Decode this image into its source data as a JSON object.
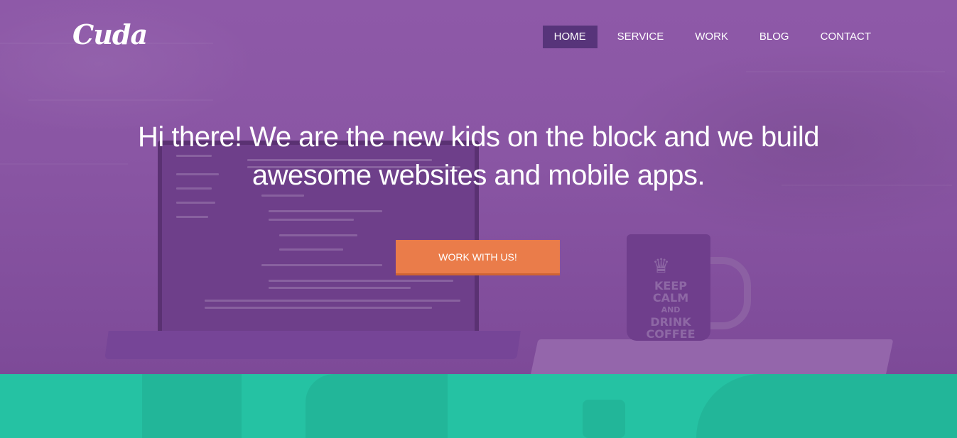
{
  "brand": {
    "logo_text": "Cuda"
  },
  "nav": {
    "items": [
      {
        "label": "HOME",
        "active": true
      },
      {
        "label": "SERVICE",
        "active": false
      },
      {
        "label": "WORK",
        "active": false
      },
      {
        "label": "BLOG",
        "active": false
      },
      {
        "label": "CONTACT",
        "active": false
      }
    ]
  },
  "hero": {
    "headline_line1": "Hi there! We are the new kids on the block and we build",
    "headline_line2": "awesome websites and mobile apps.",
    "cta_label": "WORK WITH US!",
    "background_photo": {
      "mug_text": [
        "KEEP",
        "CALM",
        "AND",
        "DRINK",
        "COFFEE"
      ]
    }
  },
  "colors": {
    "hero_overlay": "#8a55a3",
    "nav_active": "#57347a",
    "cta": "#ea7c4a",
    "teal_section": "#25c2a3",
    "text": "#ffffff"
  }
}
